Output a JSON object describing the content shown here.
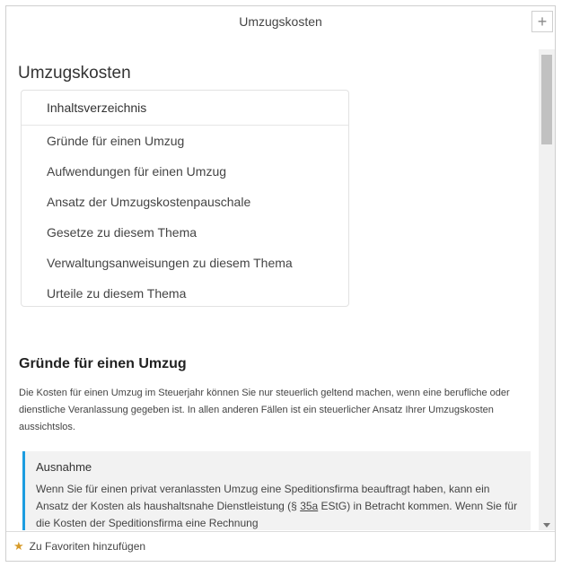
{
  "window": {
    "title": "Umzugskosten",
    "add_button": "+"
  },
  "page": {
    "title": "Umzugskosten"
  },
  "toc": {
    "heading": "Inhaltsverzeichnis",
    "items": [
      "Gründe für einen Umzug",
      "Aufwendungen für einen Umzug",
      "Ansatz der Umzugskostenpauschale",
      "Gesetze zu diesem Thema",
      "Verwaltungsanweisungen zu diesem Thema",
      "Urteile zu diesem Thema"
    ]
  },
  "section": {
    "heading": "Gründe für einen Umzug",
    "text": "Die Kosten für einen Umzug im Steuerjahr können Sie nur steuerlich geltend machen, wenn eine berufliche oder dienstliche Veranlassung gegeben ist. In allen anderen Fällen ist ein steuerlicher Ansatz Ihrer Umzugskosten aussichtslos."
  },
  "note": {
    "title": "Ausnahme",
    "text_before": "Wenn Sie für einen privat veranlassten Umzug eine Speditionsfirma beauftragt haben, kann ein Ansatz der Kosten als haushaltsnahe Dienstleistung (§ ",
    "link": "35a",
    "text_after": " EStG) in Betracht kommen. Wenn Sie für die Kosten der Speditionsfirma eine Rechnung"
  },
  "footer": {
    "favorite_label": "Zu Favoriten hinzufügen",
    "icon": "star-icon"
  },
  "colors": {
    "accent": "#1c9ce0",
    "star": "#d79b2a",
    "note_bg": "#f2f2f2"
  }
}
